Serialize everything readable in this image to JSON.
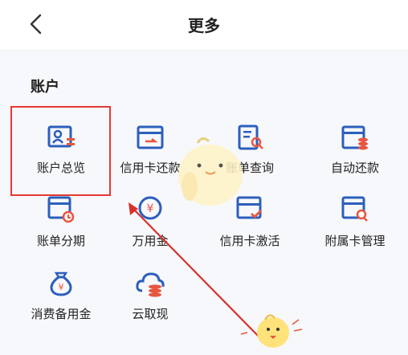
{
  "header": {
    "title": "更多"
  },
  "section": {
    "title": "账户"
  },
  "items": [
    {
      "label": "账户总览",
      "icon": "account-overview-icon"
    },
    {
      "label": "信用卡还款",
      "icon": "credit-card-repay-icon"
    },
    {
      "label": "账单查询",
      "icon": "bill-query-icon"
    },
    {
      "label": "自动还款",
      "icon": "auto-repay-icon"
    },
    {
      "label": "账单分期",
      "icon": "bill-installment-icon"
    },
    {
      "label": "万用金",
      "icon": "yen-coin-icon"
    },
    {
      "label": "信用卡激活",
      "icon": "card-activate-icon"
    },
    {
      "label": "附属卡管理",
      "icon": "supplementary-card-icon"
    },
    {
      "label": "消费备用金",
      "icon": "money-bag-icon"
    },
    {
      "label": "云取现",
      "icon": "cloud-cash-icon"
    }
  ],
  "colors": {
    "icon_blue": "#2c5fbd",
    "icon_orange": "#e8563f",
    "highlight_red": "#e53935"
  }
}
